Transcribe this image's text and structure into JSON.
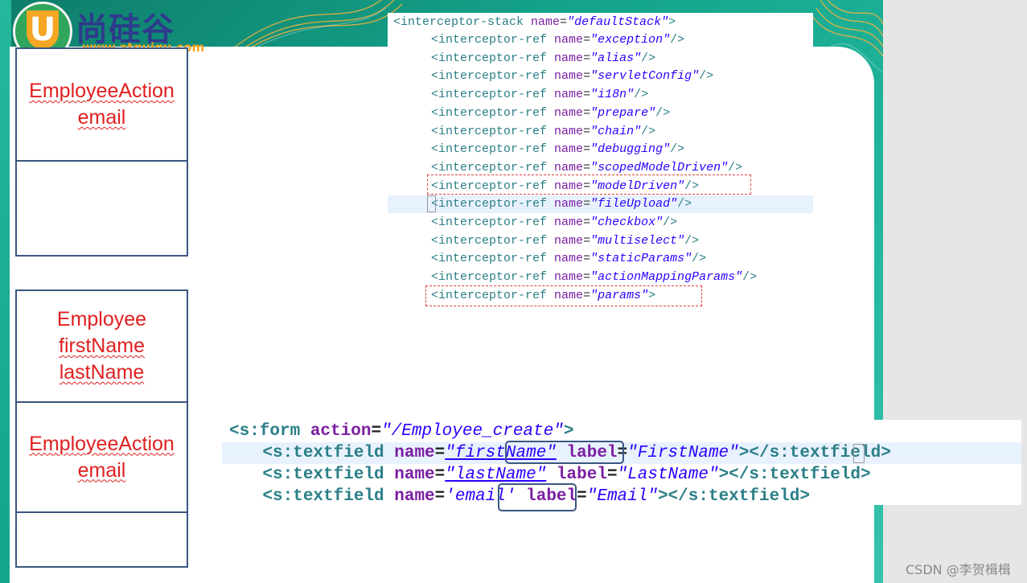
{
  "logo": {
    "mark": "U",
    "name": "尚硅谷",
    "url": "www.atguigu.com"
  },
  "boxes": {
    "top": [
      "EmployeeAction",
      "email"
    ],
    "middle": [
      "Employee",
      "firstName",
      "lastName"
    ],
    "bottom": [
      "EmployeeAction",
      "email"
    ]
  },
  "xml_code": {
    "stack_open": {
      "tag": "<interceptor-stack ",
      "attr": "name",
      "value": "\"defaultStack\"",
      "close": ">"
    },
    "refs": [
      {
        "tag": "<interceptor-ref ",
        "attr": "name",
        "value": "\"exception\"",
        "close": "/>"
      },
      {
        "tag": "<interceptor-ref ",
        "attr": "name",
        "value": "\"alias\"",
        "close": "/>"
      },
      {
        "tag": "<interceptor-ref ",
        "attr": "name",
        "value": "\"servletConfig\"",
        "close": "/>"
      },
      {
        "tag": "<interceptor-ref ",
        "attr": "name",
        "value": "\"i18n\"",
        "close": "/>"
      },
      {
        "tag": "<interceptor-ref ",
        "attr": "name",
        "value": "\"prepare\"",
        "close": "/>"
      },
      {
        "tag": "<interceptor-ref ",
        "attr": "name",
        "value": "\"chain\"",
        "close": "/>"
      },
      {
        "tag": "<interceptor-ref ",
        "attr": "name",
        "value": "\"debugging\"",
        "close": "/>"
      },
      {
        "tag": "<interceptor-ref ",
        "attr": "name",
        "value": "\"scopedModelDriven\"",
        "close": "/>"
      },
      {
        "tag": "<interceptor-ref ",
        "attr": "name",
        "value": "\"modelDriven\"",
        "close": "/>"
      },
      {
        "tag": "<interceptor-ref ",
        "attr": "name",
        "value": "\"fileUpload\"",
        "close": "/>"
      },
      {
        "tag": "<interceptor-ref ",
        "attr": "name",
        "value": "\"checkbox\"",
        "close": "/>"
      },
      {
        "tag": "<interceptor-ref ",
        "attr": "name",
        "value": "\"multiselect\"",
        "close": "/>"
      },
      {
        "tag": "<interceptor-ref ",
        "attr": "name",
        "value": "\"staticParams\"",
        "close": "/>"
      },
      {
        "tag": "<interceptor-ref ",
        "attr": "name",
        "value": "\"actionMappingParams\"",
        "close": "/>"
      },
      {
        "tag": "<interceptor-ref ",
        "attr": "name",
        "value": "\"params\"",
        "close": ">"
      }
    ]
  },
  "form_code": {
    "line1": {
      "tag": "<s:form ",
      "attr": "action",
      "eq": "=",
      "value": "\"/Employee_create\"",
      "close": ">"
    },
    "fields": [
      {
        "open": "<s:textfield ",
        "name_attr": "name",
        "name_value": "\"firstName\"",
        "label_attr": "label",
        "label_value": "\"FirstName\"",
        "close": "></s:textfield>"
      },
      {
        "open": "<s:textfield ",
        "name_attr": "name",
        "name_value": "\"lastName\"",
        "label_attr": "label",
        "label_value": "\"LastName\"",
        "close": "></s:textfield>"
      },
      {
        "open": "<s:textfield ",
        "name_attr": "name",
        "name_value": "'email'",
        "label_attr": "label",
        "label_value": "\"Email\"",
        "close": "></s:textfield>"
      }
    ]
  },
  "watermark": "CSDN @李贺楫楫",
  "colors": {
    "frame_green": "#15a48a",
    "box_border": "#3a5780",
    "red_text": "#e02020",
    "xml_tag": "#2a7f87",
    "xml_attr": "#7b1fa2",
    "xml_value": "#2a00ff",
    "highlight_line": "#e8f2fe",
    "dashed_box": "#e04040"
  }
}
